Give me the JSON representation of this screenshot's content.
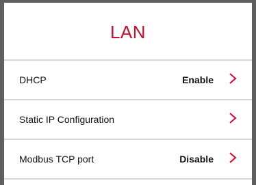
{
  "screen": {
    "title": "LAN",
    "accent_color": "#c8102e",
    "rows": [
      {
        "label": "DHCP",
        "value": "Enable",
        "icon": "chevron-right-icon"
      },
      {
        "label": "Static IP Configuration",
        "value": "",
        "icon": "chevron-right-icon"
      },
      {
        "label": "Modbus TCP port",
        "value": "Disable",
        "icon": "chevron-right-icon"
      }
    ]
  }
}
